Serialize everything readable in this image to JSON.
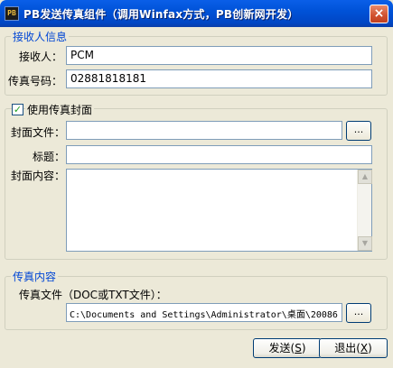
{
  "window": {
    "icon_text": "PB",
    "title": "PB发送传真组件（调用Winfax方式，PB创新网开发）",
    "close_label": "×"
  },
  "recipient": {
    "group_title": "接收人信息",
    "receiver_label": "接收人：",
    "receiver_value": "PCM",
    "fax_label": "传真号码：",
    "fax_value": "02881818181"
  },
  "cover": {
    "use_cover_label": "使用传真封面",
    "use_cover_checked": true,
    "check_mark": "✓",
    "file_label": "封面文件：",
    "file_value": "",
    "browse_label": "...",
    "subject_label": "标题：",
    "subject_value": "",
    "content_label": "封面内容：",
    "content_value": "",
    "scroll_up": "▲",
    "scroll_down": "▼"
  },
  "fax_content": {
    "group_title": "传真内容",
    "file_label": "传真文件（DOC或TXT文件）：",
    "file_value": "C:\\Documents and Settings\\Administrator\\桌面\\20086",
    "browse_label": "..."
  },
  "buttons": {
    "send_label": "发送(",
    "send_key": "S",
    "send_close": ")",
    "exit_label": "退出(",
    "exit_key": "X",
    "exit_close": ")"
  }
}
